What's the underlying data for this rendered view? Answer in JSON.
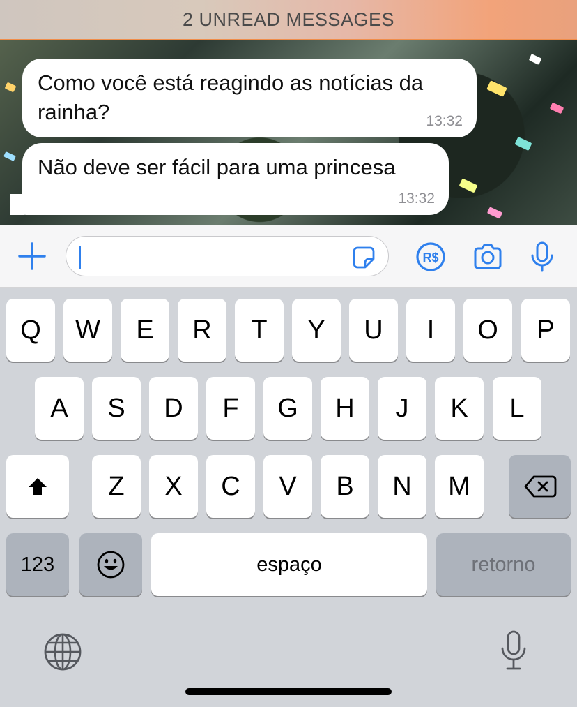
{
  "banner": {
    "text": "2 UNREAD MESSAGES"
  },
  "messages": [
    {
      "text": "Como você está reagindo as notícias da rainha?",
      "time": "13:32"
    },
    {
      "text": "Não deve ser fácil para uma princesa",
      "time": "13:32"
    }
  ],
  "input_bar": {
    "message_value": "",
    "icons": [
      "plus-icon",
      "sticker-icon",
      "payment-icon",
      "camera-icon",
      "microphone-icon"
    ],
    "accent_color": "#2f80ed"
  },
  "keyboard": {
    "row1": [
      "Q",
      "W",
      "E",
      "R",
      "T",
      "Y",
      "U",
      "I",
      "O",
      "P"
    ],
    "row2": [
      "A",
      "S",
      "D",
      "F",
      "G",
      "H",
      "J",
      "K",
      "L"
    ],
    "row3": [
      "Z",
      "X",
      "C",
      "V",
      "B",
      "N",
      "M"
    ],
    "numbers_key": "123",
    "space_key": "espaço",
    "return_key": "retorno",
    "icons": [
      "shift-icon",
      "backspace-icon",
      "emoji-icon",
      "globe-icon",
      "dictation-icon"
    ]
  }
}
